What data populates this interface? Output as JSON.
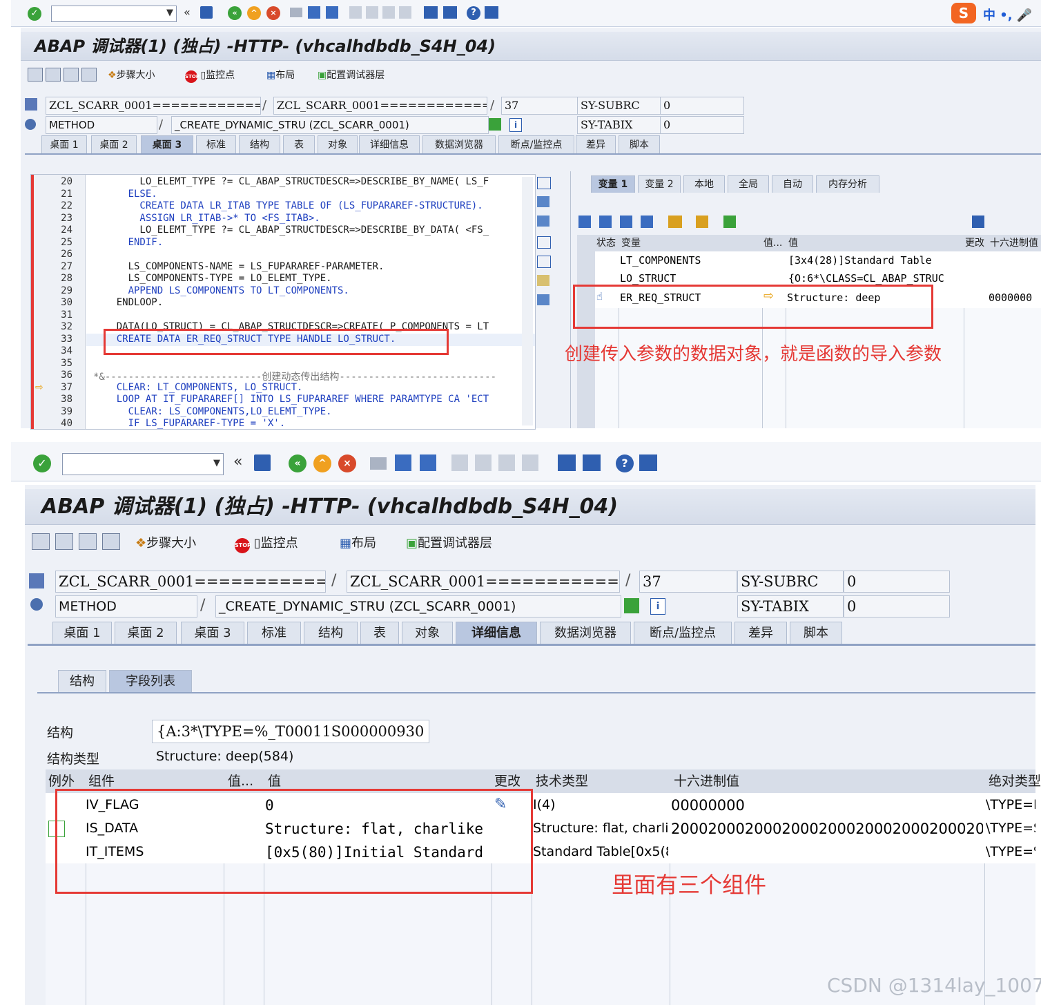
{
  "top": {
    "app_title": "ABAP 调试器(1) (独占) -HTTP- (vhcalhdbdb_S4H_04)",
    "app_toolbar": {
      "step_size": "步骤大小",
      "watchpoint": "监控点",
      "layout": "布局",
      "config_layers": "配置调试器层"
    },
    "fields": {
      "program1": "ZCL_SCARR_0001===============",
      "program2": "ZCL_SCARR_0001===============",
      "line": "37",
      "sy_subrc_label": "SY-SUBRC",
      "sy_subrc_value": "0",
      "type": "METHOD",
      "method": "_CREATE_DYNAMIC_STRU (ZCL_SCARR_0001)",
      "sy_tabix_label": "SY-TABIX",
      "sy_tabix_value": "0",
      "slash": "/"
    },
    "tabs": [
      "桌面 1",
      "桌面 2",
      "桌面 3",
      "标准",
      "结构",
      "表",
      "对象",
      "详细信息",
      "数据浏览器",
      "断点/监控点",
      "差异",
      "脚本"
    ],
    "active_tab": 2,
    "code_lines": [
      {
        "n": "20",
        "text": "        LO_ELEMT_TYPE ?= CL_ABAP_STRUCTDESCR=>DESCRIBE_BY_NAME( LS_F"
      },
      {
        "n": "21",
        "text": "      ELSE."
      },
      {
        "n": "22",
        "text": "        CREATE DATA LR_ITAB TYPE TABLE OF (LS_FUPARAREF-STRUCTURE)."
      },
      {
        "n": "23",
        "text": "        ASSIGN LR_ITAB->* TO <FS_ITAB>."
      },
      {
        "n": "24",
        "text": "        LO_ELEMT_TYPE ?= CL_ABAP_STRUCTDESCR=>DESCRIBE_BY_DATA( <FS_"
      },
      {
        "n": "25",
        "text": "      ENDIF."
      },
      {
        "n": "26",
        "text": ""
      },
      {
        "n": "27",
        "text": "      LS_COMPONENTS-NAME = LS_FUPARAREF-PARAMETER."
      },
      {
        "n": "28",
        "text": "      LS_COMPONENTS-TYPE = LO_ELEMT_TYPE."
      },
      {
        "n": "29",
        "text": "      APPEND LS_COMPONENTS TO LT_COMPONENTS."
      },
      {
        "n": "30",
        "text": "    ENDLOOP."
      },
      {
        "n": "31",
        "text": ""
      },
      {
        "n": "32",
        "text": "    DATA(LO_STRUCT) = CL_ABAP_STRUCTDESCR=>CREATE( P_COMPONENTS = LT"
      },
      {
        "n": "33",
        "text": "    CREATE DATA ER_REQ_STRUCT TYPE HANDLE LO_STRUCT."
      },
      {
        "n": "34",
        "text": ""
      },
      {
        "n": "35",
        "text": ""
      },
      {
        "n": "36",
        "text": "*&---------------------------创建动态传出结构---------------------------"
      },
      {
        "n": "37",
        "text": "    CLEAR: LT_COMPONENTS, LO_STRUCT."
      },
      {
        "n": "38",
        "text": "    LOOP AT IT_FUPARAREF[] INTO LS_FUPARAREF WHERE PARAMTYPE CA 'ECT"
      },
      {
        "n": "39",
        "text": "      CLEAR: LS_COMPONENTS,LO_ELEMT_TYPE."
      },
      {
        "n": "40",
        "text": "      IF LS_FUPARAREF-TYPE = 'X'."
      }
    ],
    "var_tabs": [
      "变量 1",
      "变量 2",
      "本地",
      "全局",
      "自动",
      "内存分析"
    ],
    "var_headers": {
      "status": "状态",
      "variable": "变量",
      "val_short": "值...",
      "value": "值",
      "changed": "更改",
      "hex": "十六进制值"
    },
    "var_rows": [
      {
        "name": "LT_COMPONENTS",
        "value": "[3x4(28)]Standard Table",
        "hex": ""
      },
      {
        "name": "LO_STRUCT",
        "value": "{O:6*\\CLASS=CL_ABAP_STRUC",
        "hex": ""
      },
      {
        "name": "ER_REQ_STRUCT",
        "value": "Structure: deep",
        "hex": "0000000"
      }
    ],
    "annotation": "创建传入参数的数据对象，就是函数的导入参数"
  },
  "bottom": {
    "app_title": "ABAP 调试器(1) (独占) -HTTP- (vhcalhdbdb_S4H_04)",
    "app_toolbar": {
      "step_size": "步骤大小",
      "watchpoint": "监控点",
      "layout": "布局",
      "config_layers": "配置调试器层"
    },
    "fields": {
      "program1": "ZCL_SCARR_0001===============",
      "program2": "ZCL_SCARR_0001===============",
      "line": "37",
      "sy_subrc_label": "SY-SUBRC",
      "sy_subrc_value": "0",
      "type": "METHOD",
      "method": "_CREATE_DYNAMIC_STRU (ZCL_SCARR_0001)",
      "sy_tabix_label": "SY-TABIX",
      "sy_tabix_value": "0",
      "slash": "/"
    },
    "tabs": [
      "桌面 1",
      "桌面 2",
      "桌面 3",
      "标准",
      "结构",
      "表",
      "对象",
      "详细信息",
      "数据浏览器",
      "断点/监控点",
      "差异",
      "脚本"
    ],
    "active_tab": 7,
    "sub_tabs": [
      "结构",
      "字段列表"
    ],
    "structure_label": "结构",
    "structure_value": "{A:3*\\TYPE=%_T00011S000000930",
    "structure_type_label": "结构类型",
    "structure_type_value": "Structure: deep(584)",
    "headers": {
      "exception": "例外",
      "component": "组件",
      "val_short": "值...",
      "value": "值",
      "changed": "更改",
      "tech_type": "技术类型",
      "hex": "十六进制值",
      "abs_type": "绝对类型"
    },
    "rows": [
      {
        "component": "IV_FLAG",
        "value": "0",
        "tech_type": "I(4)",
        "hex": "00000000",
        "abs_type": "\\TYPE=I"
      },
      {
        "component": "IS_DATA",
        "value": "Structure: flat, charlike",
        "tech_type": "Structure: flat, charlike",
        "hex": "200020002000200020002000200020002000200",
        "abs_type": "\\TYPE=S"
      },
      {
        "component": "IT_ITEMS",
        "value": "[0x5(80)]Initial Standard",
        "tech_type": "Standard Table[0x5(8",
        "hex": "",
        "abs_type": "\\TYPE=%"
      }
    ],
    "annotation": "里面有三个组件"
  },
  "watermark": "CSDN @1314lay_1007",
  "colors": {
    "accent_red": "#e53935",
    "keyword_blue": "#1e3fbf",
    "ok_green": "#3aa23a"
  }
}
